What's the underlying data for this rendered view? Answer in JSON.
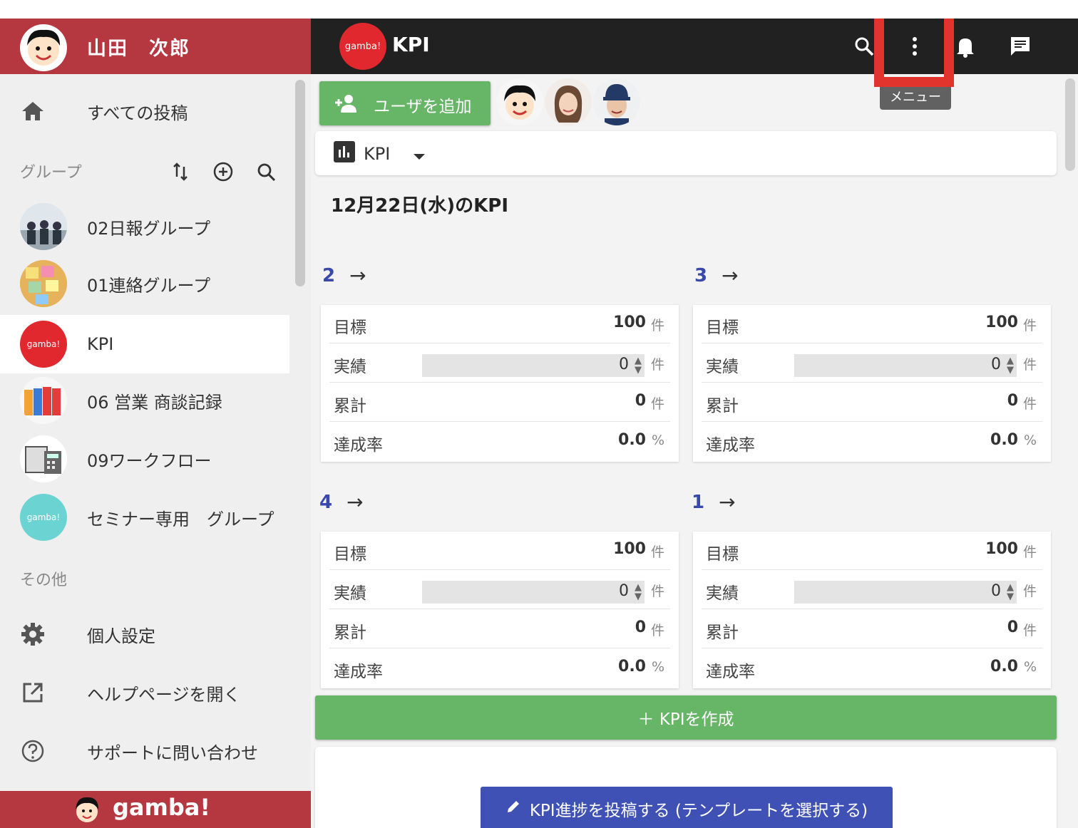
{
  "sidebar": {
    "user_name": "山田　次郎",
    "all_posts": "すべての投稿",
    "groups_label": "グループ",
    "groups": [
      {
        "label": "02日報グループ",
        "avatar": "photo"
      },
      {
        "label": "01連絡グループ",
        "avatar": "photo"
      },
      {
        "label": "KPI",
        "avatar": "gamba",
        "avatar_text": "gamba!",
        "color": "#e0282e"
      },
      {
        "label": "06 営業 商談記録",
        "avatar": "binders"
      },
      {
        "label": "09ワークフロー",
        "avatar": "calculator"
      },
      {
        "label": "セミナー専用　グループ",
        "avatar": "gamba",
        "avatar_text": "gamba!",
        "color": "#6cd3d3"
      }
    ],
    "other_label": "その他",
    "settings": "個人設定",
    "help": "ヘルプページを開く",
    "support": "サポートに問い合わせ",
    "footer_logo": "gamba!"
  },
  "topbar": {
    "logo_text": "gamba!",
    "title": "KPI",
    "tooltip": "メニュー"
  },
  "main": {
    "add_user": "ユーザを追加",
    "kpi_select": "KPI",
    "date_title": "12月22日(水)のKPI",
    "row_labels": {
      "target": "目標",
      "actual": "実績",
      "total": "累計",
      "rate": "達成率"
    },
    "cards": [
      {
        "name": "2",
        "target": "100",
        "actual": "0",
        "total": "0",
        "rate": "0.0"
      },
      {
        "name": "3",
        "target": "100",
        "actual": "0",
        "total": "0",
        "rate": "0.0"
      },
      {
        "name": "4",
        "target": "100",
        "actual": "0",
        "total": "0",
        "rate": "0.0"
      },
      {
        "name": "1",
        "target": "100",
        "actual": "0",
        "total": "0",
        "rate": "0.0"
      }
    ],
    "unit_count": "件",
    "unit_percent": "%",
    "create_kpi": "＋ KPIを作成",
    "post_progress": "KPI進捗を投稿する (テンプレートを選択する)"
  },
  "colors": {
    "brand_red": "#b5373f",
    "green": "#67b567",
    "indigo": "#3f51b5",
    "highlight": "#e0342c"
  }
}
